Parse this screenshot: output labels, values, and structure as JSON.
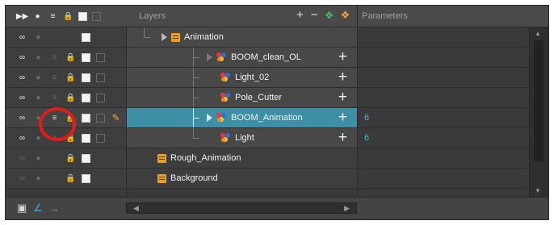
{
  "header": {
    "layers_label": "Layers",
    "parameters_label": "Parameters",
    "toggle_icons": [
      "animate-toggle-icon",
      "show-hide-toggle-icon",
      "stack-toggle-icon",
      "lock-toggle-icon",
      "color-swatch-icon",
      "thumbnail-icon"
    ],
    "tools": [
      "add-layer-icon",
      "delete-layer-icon",
      "add-peg-icon",
      "add-group-icon"
    ]
  },
  "layers": [
    {
      "name": "Animation",
      "value": "",
      "indent": 0,
      "type": "group",
      "expanded_arrow": true,
      "dim": false,
      "selected": false
    },
    {
      "name": "BOOM_clean_OL",
      "value": "",
      "indent": 2,
      "type": "drawing",
      "expanded_arrow": true,
      "dim": true,
      "selected": false
    },
    {
      "name": "Light_02",
      "value": "",
      "indent": 2,
      "type": "drawing",
      "expanded_arrow": false,
      "dim": true,
      "selected": false
    },
    {
      "name": "Pole_Cutter",
      "value": "",
      "indent": 2,
      "type": "drawing",
      "expanded_arrow": false,
      "dim": true,
      "selected": false
    },
    {
      "name": "BOOM_Animation",
      "value": "6",
      "indent": 2,
      "type": "drawing",
      "expanded_arrow": true,
      "dim": false,
      "selected": true
    },
    {
      "name": "Light",
      "value": "6",
      "indent": 2,
      "type": "drawing",
      "expanded_arrow": false,
      "dim": false,
      "selected": false
    },
    {
      "name": "Rough_Animation",
      "value": "",
      "indent": 0,
      "type": "group",
      "expanded_arrow": false,
      "dim": true,
      "selected": false
    },
    {
      "name": "Background",
      "value": "",
      "indent": 0,
      "type": "group",
      "expanded_arrow": false,
      "dim": true,
      "selected": false
    }
  ],
  "colors": {
    "selection": "#3d8fa5",
    "param_value": "#46b4e0",
    "highlight_ring": "#e21b1b",
    "pencil": "#f2a43a"
  },
  "footer": {
    "icons": [
      "camera-view-icon",
      "function-curve-icon",
      "arrow-right-icon"
    ]
  }
}
